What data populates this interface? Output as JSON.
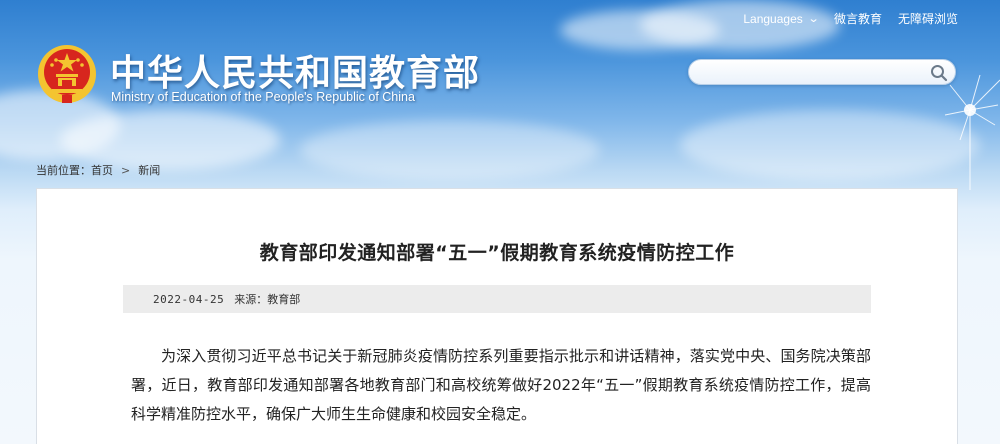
{
  "header": {
    "site_title": "中华人民共和国教育部",
    "site_subtitle": "Ministry of Education of the People's Republic of China"
  },
  "topnav": {
    "languages_label": "Languages",
    "weibo_label": "微言教育",
    "accessibility_label": "无障碍浏览"
  },
  "search": {
    "placeholder": ""
  },
  "breadcrumb": {
    "prefix": "当前位置：",
    "home": "首页",
    "separator": ">",
    "current": "新闻"
  },
  "article": {
    "title": "教育部印发通知部署“五一”假期教育系统疫情防控工作",
    "date": "2022-04-25",
    "source": "来源：教育部",
    "body": "为深入贯彻习近平总书记关于新冠肺炎疫情防控系列重要指示批示和讲话精神，落实党中央、国务院决策部署，近日，教育部印发通知部署各地教育部门和高校统筹做好2022年“五一”假期教育系统疫情防控工作，提高科学精准防控水平，确保广大师生生命健康和校园安全稳定。"
  },
  "colors": {
    "sky_top": "#2f7fd0",
    "sky_bottom": "#f3f8fd",
    "emblem_red": "#d7261e",
    "emblem_gold": "#f4c430"
  },
  "icons": {
    "emblem": "national-emblem-icon",
    "search": "search-icon",
    "languages_chevron": "chevron-down-icon"
  }
}
